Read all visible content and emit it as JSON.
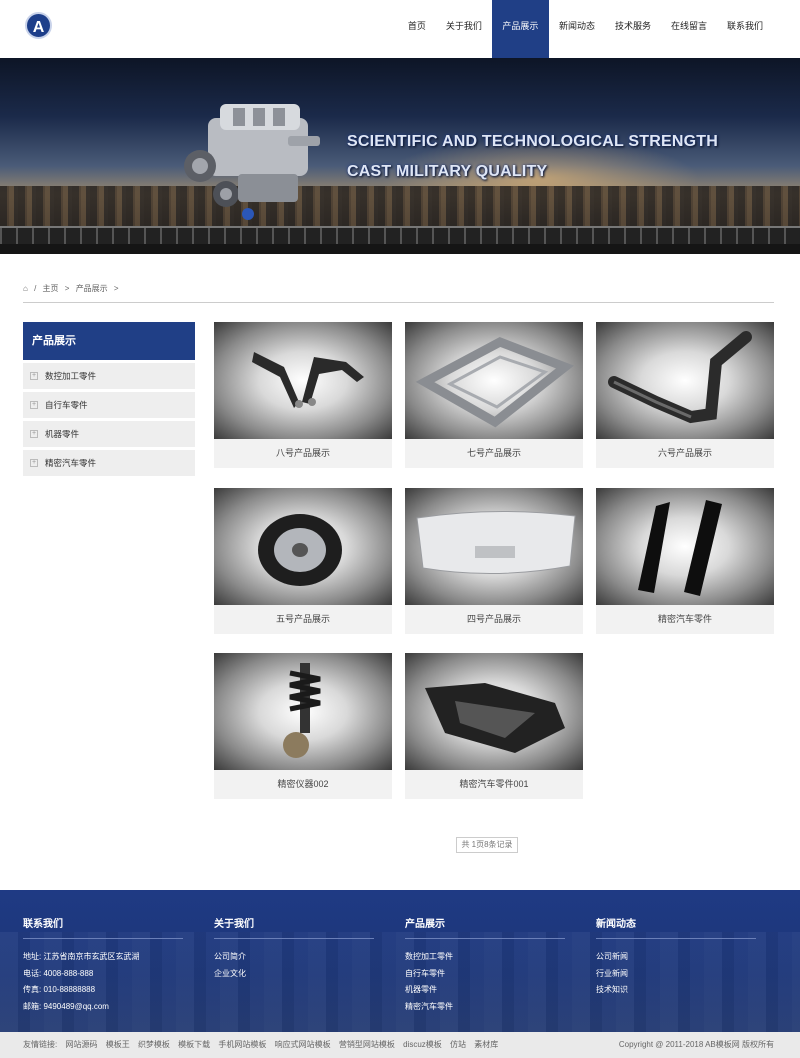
{
  "header": {
    "logo_text": "A",
    "nav": [
      "首页",
      "关于我们",
      "产品展示",
      "新闻动态",
      "技术服务",
      "在线留言",
      "联系我们"
    ],
    "active_index": 2
  },
  "banner": {
    "line1": "SCIENTIFIC AND TECHNOLOGICAL STRENGTH",
    "line2": "CAST MILITARY QUALITY"
  },
  "breadcrumb": {
    "home_icon": "home-icon",
    "sep": "/",
    "home": "主页",
    "current": "产品展示",
    "arrow": ">"
  },
  "sidebar": {
    "title": "产品展示",
    "items": [
      "数控加工零件",
      "自行车零件",
      "机器零件",
      "精密汽车零件"
    ]
  },
  "products": [
    {
      "caption": "八号产品展示",
      "icon": "control-arm-icon"
    },
    {
      "caption": "七号产品展示",
      "icon": "frame-icon"
    },
    {
      "caption": "六号产品展示",
      "icon": "pipe-icon"
    },
    {
      "caption": "五号产品展示",
      "icon": "tire-icon"
    },
    {
      "caption": "四号产品展示",
      "icon": "bumper-icon"
    },
    {
      "caption": "精密汽车零件",
      "icon": "pillar-icon"
    },
    {
      "caption": "精密仪器002",
      "icon": "shock-absorber-icon"
    },
    {
      "caption": "精密汽车零件001",
      "icon": "subframe-icon"
    }
  ],
  "pager": {
    "text": "共 1页8条记录"
  },
  "footer": {
    "contact": {
      "title": "联系我们",
      "lines": [
        "地址: 江苏省南京市玄武区玄武湖",
        "电话: 4008-888-888",
        "传真: 010-88888888",
        "邮箱: 9490489@qq.com"
      ]
    },
    "about": {
      "title": "关于我们",
      "items": [
        "公司简介",
        "企业文化"
      ]
    },
    "products": {
      "title": "产品展示",
      "items": [
        "数控加工零件",
        "自行车零件",
        "机器零件",
        "精密汽车零件"
      ]
    },
    "news": {
      "title": "新闻动态",
      "items": [
        "公司新闻",
        "行业新闻",
        "技术知识"
      ]
    }
  },
  "bottom": {
    "links_label": "友情链接:",
    "links": [
      "网站源码",
      "模板王",
      "织梦模板",
      "模板下载",
      "手机网站模板",
      "响应式网站模板",
      "营销型网站模板",
      "discuz模板",
      "仿站",
      "素材库"
    ],
    "copyright": "Copyright @ 2011-2018 AB模板网 版权所有"
  },
  "colors": {
    "brand": "#203f86",
    "footer": "#1f3a84"
  }
}
